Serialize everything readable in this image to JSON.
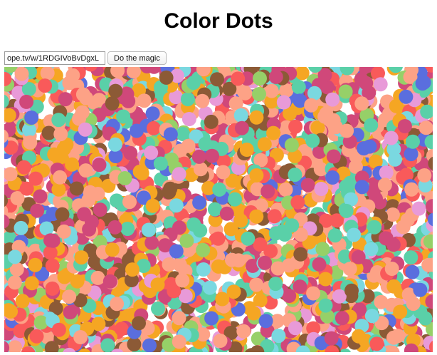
{
  "page": {
    "title": "Color Dots"
  },
  "controls": {
    "url_value": "ope.tv/w/1RDGIVoBvDgxL",
    "magic_label": "Do the magic"
  },
  "palette": {
    "salmon": "#fda286",
    "orange": "#f5a623",
    "magenta": "#d0487a",
    "teal": "#5ad0a8",
    "brown": "#8c5a36",
    "coral": "#f95a5a",
    "blue": "#5a6ede",
    "pink": "#e89ad8",
    "cyan": "#7ad8e0",
    "green": "#96d068"
  }
}
